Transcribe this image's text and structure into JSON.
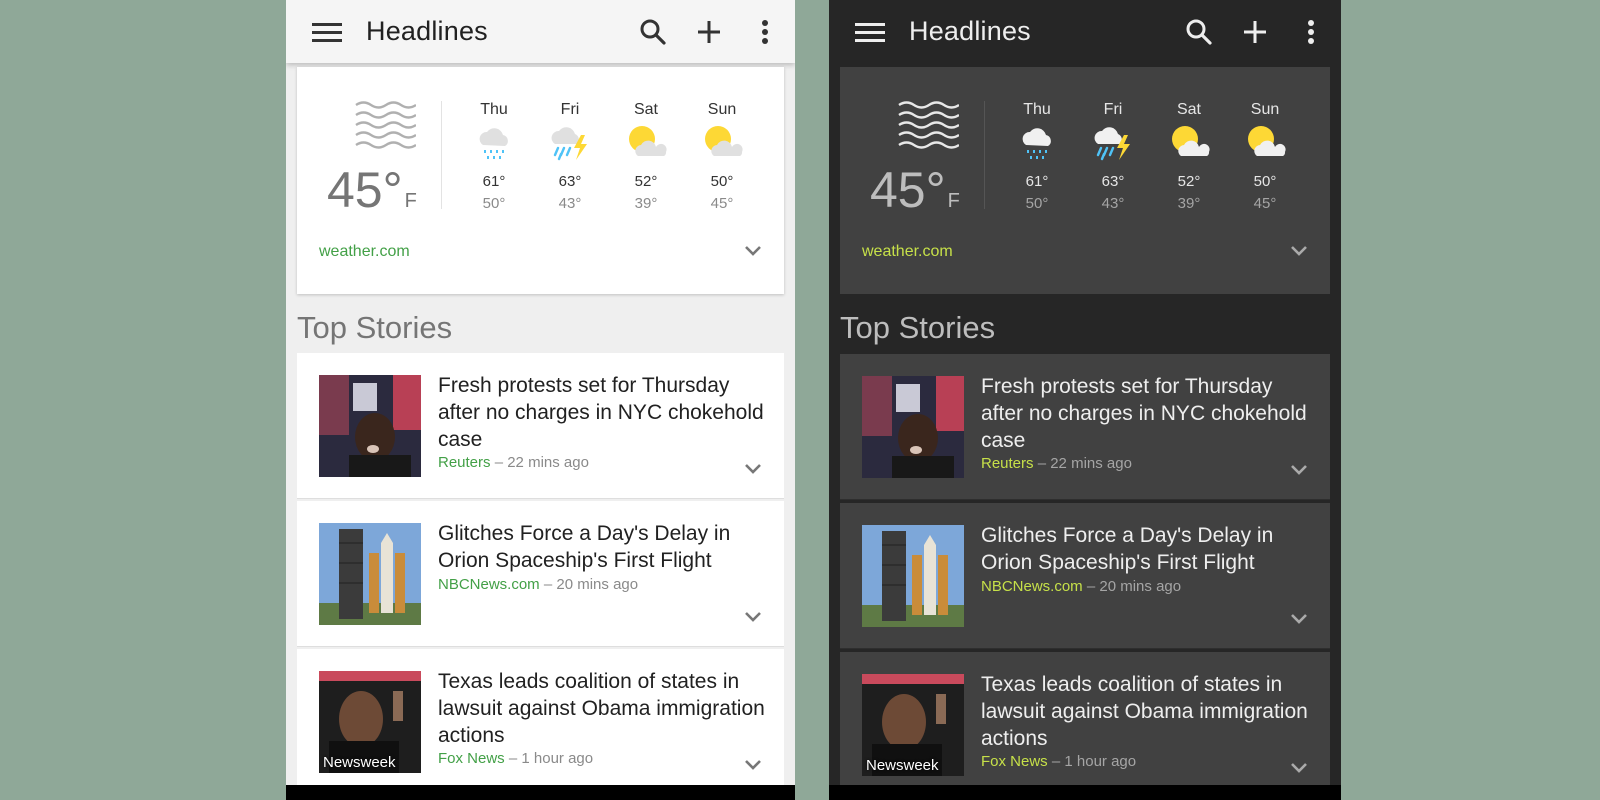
{
  "app": {
    "title": "Headlines"
  },
  "weather": {
    "current_temp": "45°",
    "unit": "F",
    "current_icon": "waves-icon",
    "source": "weather.com",
    "forecast": [
      {
        "day": "Thu",
        "high": "61°",
        "low": "50°",
        "icon": "rain-icon"
      },
      {
        "day": "Fri",
        "high": "63°",
        "low": "43°",
        "icon": "thunderstorm-icon"
      },
      {
        "day": "Sat",
        "high": "52°",
        "low": "39°",
        "icon": "partly-cloudy-icon"
      },
      {
        "day": "Sun",
        "high": "50°",
        "low": "45°",
        "icon": "partly-cloudy-icon"
      }
    ]
  },
  "section_title": "Top Stories",
  "stories": [
    {
      "headline": "Fresh protests set for Thursday after no charges in NYC chokehold case",
      "source": "Reuters",
      "time": "22 mins ago"
    },
    {
      "headline": "Glitches Force a Day's Delay in Orion Spaceship's First Flight",
      "source": "NBCNews.com",
      "time": "20 mins ago"
    },
    {
      "headline": "Texas leads coalition of states in lawsuit against Obama immigration actions",
      "source": "Fox News",
      "time": "1 hour ago",
      "thumb_label": "Newsweek"
    }
  ],
  "meta_separator": "–",
  "colors": {
    "background": "#8fa898",
    "light_source_green": "#43a047",
    "dark_source_green": "#c6e049",
    "rain_blue": "#4fc3f7",
    "sun_yellow": "#fdd835",
    "cloud_gray": "#e0e0e0"
  }
}
